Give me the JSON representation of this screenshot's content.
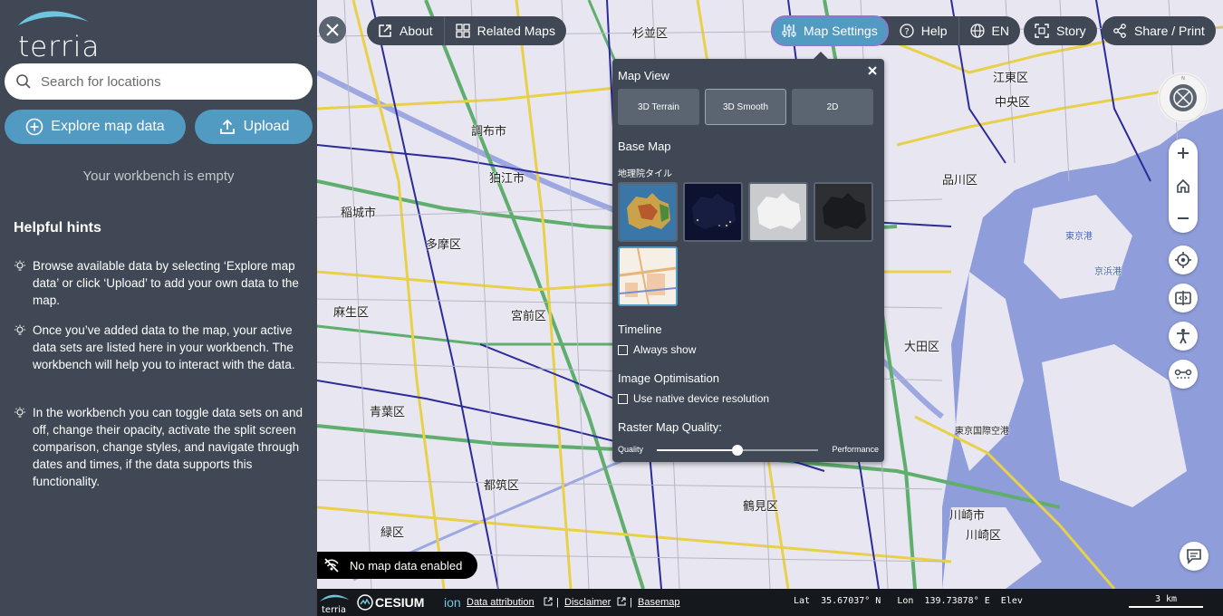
{
  "app": {
    "logo_text": "terria"
  },
  "sidebar": {
    "search_placeholder": "Search for locations",
    "explore_label": "Explore map data",
    "upload_label": "Upload",
    "workbench_empty": "Your workbench is empty",
    "hints_title": "Helpful hints",
    "hints": [
      "Browse available data by selecting ‘Explore map data’ or click ‘Upload’ to add your own data to the map.",
      "Once you’ve added data to the map, your active data sets are listed here in your workbench. The workbench will help you to interact with the data.",
      "In the workbench you can toggle data sets on and off, change their opacity, activate the split screen comparison, change styles, and navigate through dates and times, if the data supports this functionality."
    ]
  },
  "nav": {
    "about": "About",
    "related_maps": "Related Maps",
    "map_settings": "Map Settings",
    "help": "Help",
    "language": "EN",
    "story": "Story",
    "share": "Share / Print"
  },
  "map_settings": {
    "map_view_heading": "Map View",
    "view_options": [
      "3D Terrain",
      "3D Smooth",
      "2D"
    ],
    "selected_view": "3D Smooth",
    "base_map_heading": "Base Map",
    "selected_base_map": "地理院タイル",
    "timeline_heading": "Timeline",
    "timeline_always_show": "Always show",
    "image_opt_heading": "Image Optimisation",
    "native_resolution": "Use native device resolution",
    "raster_quality_heading": "Raster Map Quality:",
    "quality_label": "Quality",
    "performance_label": "Performance",
    "raster_quality_value": 0.5
  },
  "map": {
    "labels": {
      "l1": "杉並区",
      "l2": "調布市",
      "l3": "狛江市",
      "l4": "稲城市",
      "l5": "多摩区",
      "l6": "麻生区",
      "l7": "宮前区",
      "l8": "青葉区",
      "l9": "都筑区",
      "l10": "緑区",
      "l11": "鶴見区",
      "l12": "川崎市",
      "l13": "江東区",
      "l14": "中央区",
      "l15": "東京港",
      "l16": "京浜港",
      "l17": "東京国際空港",
      "l18": "川崎区",
      "l19": "大田区",
      "l20": "品川区"
    },
    "no_data": "No map data enabled"
  },
  "footer": {
    "cesium": "CESIUM",
    "ion": "ion",
    "data_attribution": "Data attribution",
    "disclaimer": "Disclaimer",
    "basemap": "Basemap",
    "coords": "Lat  35.67037° N   Lon  139.73878° E  Elev",
    "scale": "3 km",
    "bottom_logo": "terria"
  },
  "colors": {
    "sidebar_bg": "#3f4854",
    "accent": "#519ac2",
    "panel_bg": "#3f4854"
  }
}
